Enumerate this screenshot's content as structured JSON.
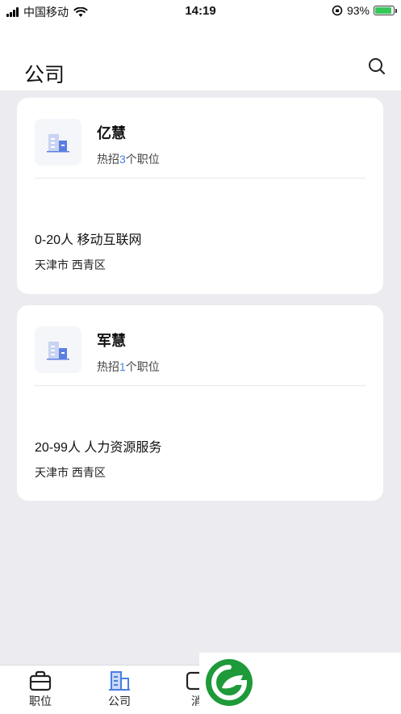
{
  "status_bar": {
    "carrier": "中国移动",
    "time": "14:19",
    "battery": "93%"
  },
  "header": {
    "title": "公司"
  },
  "companies": [
    {
      "name": "亿慧",
      "jobs_prefix": "热招",
      "jobs_count": "3",
      "jobs_suffix": "个职位",
      "info": "0-20人 移动互联网",
      "location": "天津市 西青区"
    },
    {
      "name": "军慧",
      "jobs_prefix": "热招",
      "jobs_count": "1",
      "jobs_suffix": "个职位",
      "info": "20-99人 人力资源服务",
      "location": "天津市 西青区"
    }
  ],
  "tabbar": {
    "items": [
      {
        "label": "职位",
        "icon": "briefcase-icon"
      },
      {
        "label": "公司",
        "icon": "building-icon",
        "active": true
      },
      {
        "label": "消",
        "icon": "message-icon"
      }
    ]
  },
  "colors": {
    "accent": "#4A7FE0",
    "background": "#ECEBF0",
    "logo_green": "#1E9A3A"
  }
}
